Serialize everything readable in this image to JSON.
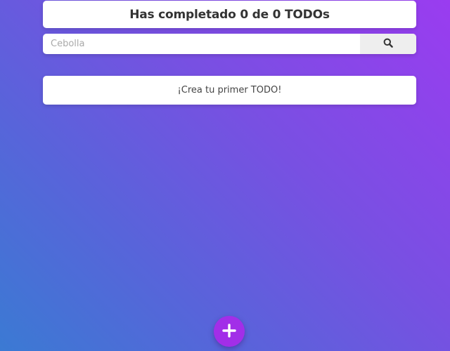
{
  "header": {
    "counter_text": "Has completado 0 de 0 TODOs"
  },
  "search": {
    "placeholder": "Cebolla",
    "value": "",
    "button_icon": "search-icon"
  },
  "todos": {
    "empty_message": "¡Crea tu primer TODO!",
    "items": []
  },
  "fab": {
    "icon": "plus-icon"
  },
  "colors": {
    "gradient_top_right": "#9a3cf0",
    "gradient_bottom_left": "#3b7ad3",
    "fab": "#a22ee8",
    "card": "#ffffff",
    "search_button_bg": "#eeeeee"
  }
}
